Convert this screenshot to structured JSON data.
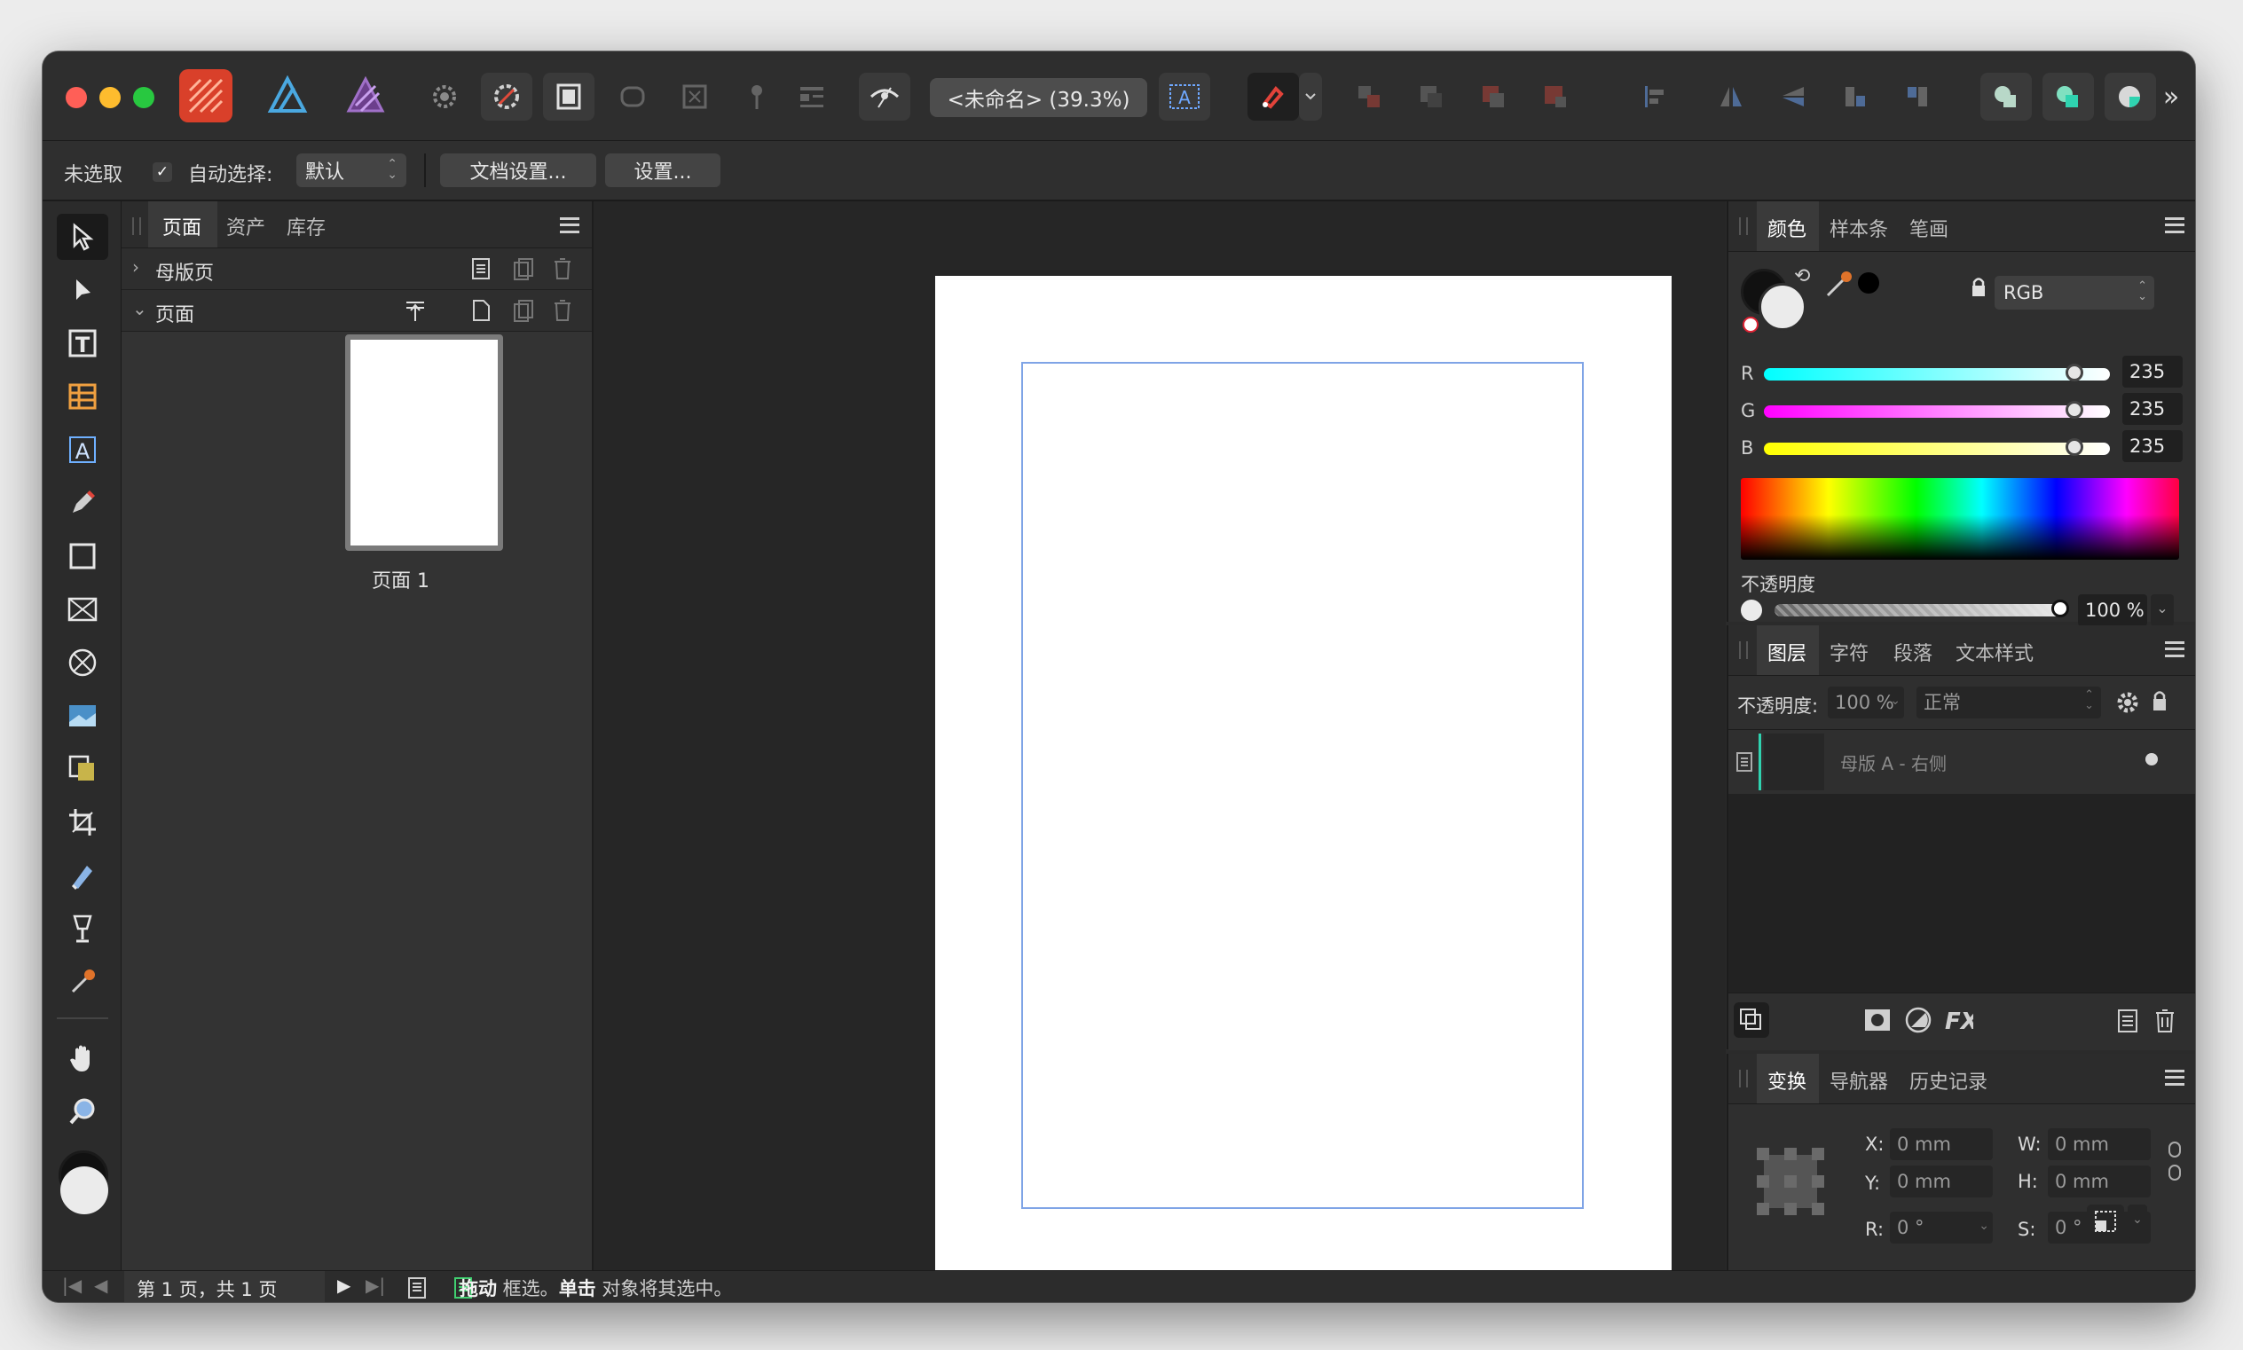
{
  "window": {
    "title": "<未命名> (39.3%)"
  },
  "context": {
    "selection": "未选取",
    "auto_select_label": "自动选择:",
    "auto_select_value": "默认",
    "doc_settings": "文档设置...",
    "settings": "设置..."
  },
  "pages_panel": {
    "tabs": [
      "页面",
      "资产",
      "库存"
    ],
    "master_section": "母版页",
    "pages_section": "页面",
    "page_label": "页面 1"
  },
  "color_panel": {
    "tabs": [
      "颜色",
      "样本条",
      "笔画"
    ],
    "model": "RGB",
    "r_label": "R",
    "g_label": "G",
    "b_label": "B",
    "r": "235",
    "g": "235",
    "b": "235",
    "opacity_label": "不透明度",
    "opacity": "100 %"
  },
  "layers_panel": {
    "tabs": [
      "图层",
      "字符",
      "段落",
      "文本样式"
    ],
    "opacity_label": "不透明度:",
    "opacity": "100 %",
    "blend": "正常",
    "layer_name": "母版 A - 右侧"
  },
  "transform_panel": {
    "tabs": [
      "变换",
      "导航器",
      "历史记录"
    ],
    "x_label": "X:",
    "y_label": "Y:",
    "w_label": "W:",
    "h_label": "H:",
    "r_label": "R:",
    "s_label": "S:",
    "x": "0 mm",
    "y": "0 mm",
    "w": "0 mm",
    "h": "0 mm",
    "r": "0 °",
    "s": "0 °"
  },
  "status": {
    "page_info": "第 1 页，共 1 页",
    "hint_drag": "拖动",
    "hint_1": " 框选。",
    "hint_click": "单击",
    "hint_2": " 对象将其选中。"
  },
  "colors": {
    "close": "#ff5f57",
    "minimize": "#febc2e",
    "zoom": "#28c840",
    "guide": "#7fa4e6",
    "accent": "#2fd3b0"
  }
}
